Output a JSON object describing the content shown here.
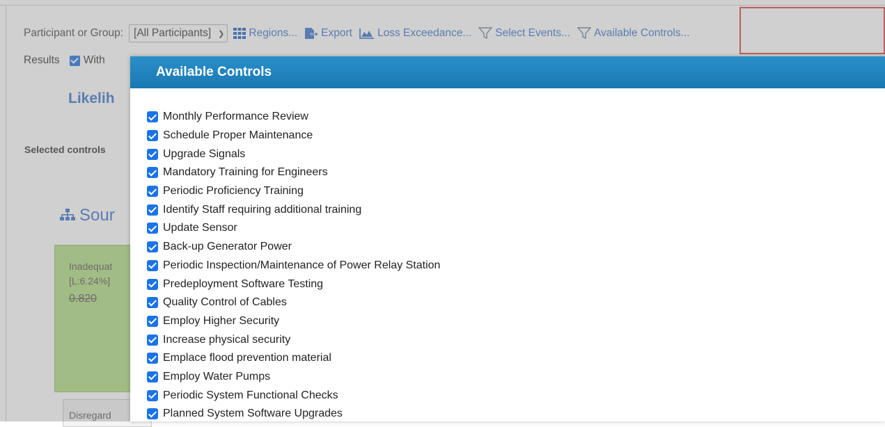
{
  "toolbar": {
    "participant_label": "Participant or Group:",
    "participant_value": "[All Participants]",
    "regions_label": "Regions...",
    "export_label": "Export",
    "loss_label": "Loss Exceedance...",
    "select_events_label": "Select Events...",
    "available_controls_label": "Available Controls..."
  },
  "row2": {
    "results_label": "Results",
    "with_label": "With"
  },
  "background": {
    "likelihood_title": "Likelih",
    "selected_controls_label": "Selected controls",
    "source_title": "Sour",
    "card_line1": "Inadequat",
    "card_line2": "[L:6.24%]",
    "card_value": "0.820",
    "card2_text": "Disregard"
  },
  "modal": {
    "title": "Available Controls",
    "items": [
      {
        "label": "Monthly Performance Review",
        "checked": true
      },
      {
        "label": "Schedule Proper Maintenance",
        "checked": true
      },
      {
        "label": "Upgrade Signals",
        "checked": true
      },
      {
        "label": "Mandatory Training for Engineers",
        "checked": true
      },
      {
        "label": "Periodic Proficiency Training",
        "checked": true
      },
      {
        "label": "Identify Staff requiring additional training",
        "checked": true
      },
      {
        "label": "Update Sensor",
        "checked": true
      },
      {
        "label": "Back-up Generator Power",
        "checked": true
      },
      {
        "label": "Periodic Inspection/Maintenance of Power Relay Station",
        "checked": true
      },
      {
        "label": "Predeployment Software Testing",
        "checked": true
      },
      {
        "label": "Quality Control of Cables",
        "checked": true
      },
      {
        "label": "Employ Higher Security",
        "checked": true
      },
      {
        "label": "Increase physical security",
        "checked": true
      },
      {
        "label": "Emplace flood prevention material",
        "checked": true
      },
      {
        "label": "Employ Water Pumps",
        "checked": true
      },
      {
        "label": "Periodic System Functional Checks",
        "checked": true
      },
      {
        "label": "Planned System Software Upgrades",
        "checked": true
      }
    ]
  },
  "colors": {
    "accent": "#4a7fd0",
    "modal_header": "#1a78b2",
    "checkbox": "#1a73e8",
    "highlight": "#e05050",
    "card_green": "#b9e08c"
  }
}
